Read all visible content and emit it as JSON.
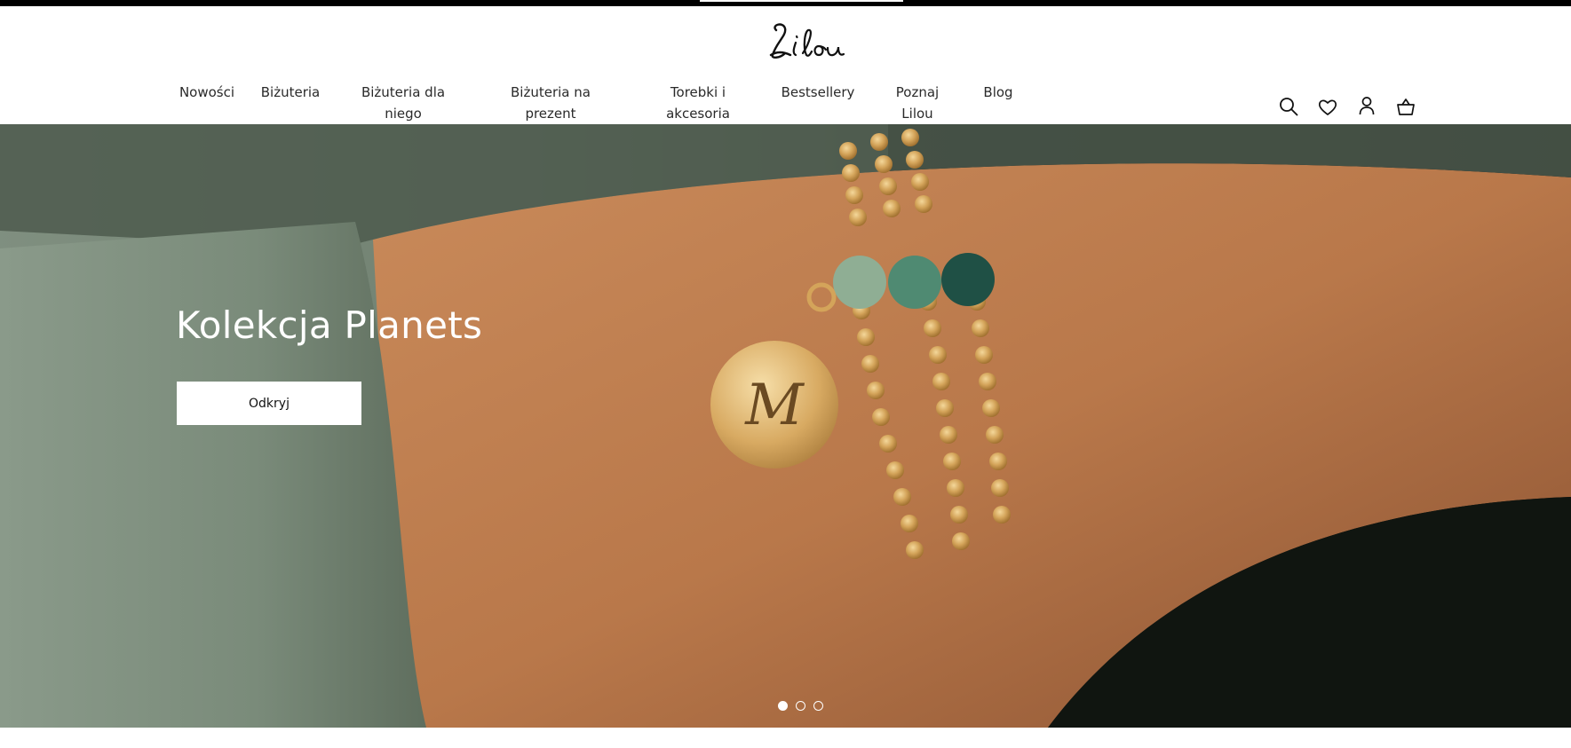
{
  "brand": {
    "logo_text": "Lilou"
  },
  "nav": {
    "items": [
      {
        "label": "Nowości"
      },
      {
        "label": "Biżuteria"
      },
      {
        "label": "Biżuteria dla niego"
      },
      {
        "label": "Biżuteria na prezent"
      },
      {
        "label": "Torebki i akcesoria"
      },
      {
        "label": "Bestsellery"
      },
      {
        "label": "Poznaj Lilou"
      },
      {
        "label": "Blog"
      }
    ]
  },
  "header_icons": [
    "search-icon",
    "heart-icon",
    "user-icon",
    "basket-icon"
  ],
  "hero": {
    "title": "Kolekcja Planets",
    "cta_label": "Odkryj",
    "slides_count": 3,
    "active_slide": 1
  },
  "colors": {
    "accent_black": "#000000",
    "text": "#2a2a2a",
    "white": "#ffffff"
  }
}
